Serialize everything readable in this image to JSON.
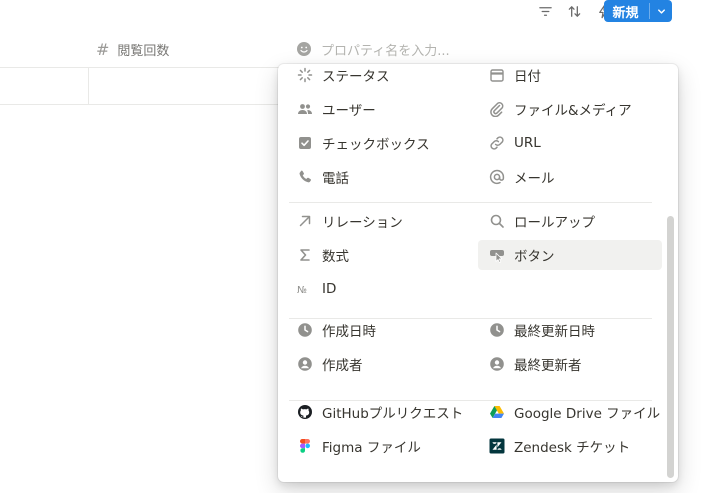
{
  "toolbar": {
    "icons": [
      "filter-icon",
      "sort-icon",
      "lightning-icon",
      "search-icon",
      "sliders-icon"
    ],
    "new_button_label": "新規"
  },
  "table": {
    "column_header": "閲覧回数",
    "property_search_placeholder": "プロパティ名を入力..."
  },
  "menu": {
    "groups": [
      {
        "left": [
          {
            "label": "ステータス",
            "icon": "status-icon"
          },
          {
            "label": "ユーザー",
            "icon": "people-icon"
          },
          {
            "label": "チェックボックス",
            "icon": "checkbox-icon"
          },
          {
            "label": "電話",
            "icon": "phone-icon"
          }
        ],
        "right": [
          {
            "label": "日付",
            "icon": "calendar-icon"
          },
          {
            "label": "ファイル&メディア",
            "icon": "paperclip-icon"
          },
          {
            "label": "URL",
            "icon": "link-icon"
          },
          {
            "label": "メール",
            "icon": "at-icon"
          }
        ]
      },
      {
        "left": [
          {
            "label": "リレーション",
            "icon": "arrow-up-right-icon"
          },
          {
            "label": "数式",
            "icon": "sigma-icon"
          },
          {
            "label": "ID",
            "icon": "numero-icon"
          }
        ],
        "right": [
          {
            "label": "ロールアップ",
            "icon": "magnifier-icon"
          },
          {
            "label": "ボタン",
            "icon": "cursor-button-icon",
            "hover": true
          }
        ]
      },
      {
        "left": [
          {
            "label": "作成日時",
            "icon": "clock-icon"
          },
          {
            "label": "作成者",
            "icon": "user-circle-icon"
          }
        ],
        "right": [
          {
            "label": "最終更新日時",
            "icon": "clock-icon"
          },
          {
            "label": "最終更新者",
            "icon": "user-circle-icon"
          }
        ]
      },
      {
        "left": [
          {
            "label": "GitHubプルリクエスト",
            "icon": "github-icon"
          },
          {
            "label": "Figma ファイル",
            "icon": "figma-icon"
          }
        ],
        "right": [
          {
            "label": "Google Drive ファイル",
            "icon": "google-drive-icon"
          },
          {
            "label": "Zendesk チケット",
            "icon": "zendesk-icon"
          }
        ]
      }
    ]
  },
  "colors": {
    "accent": "#2383e2",
    "text": "#37352f",
    "muted": "#91918e",
    "hover_bg": "#f1f1ef"
  }
}
